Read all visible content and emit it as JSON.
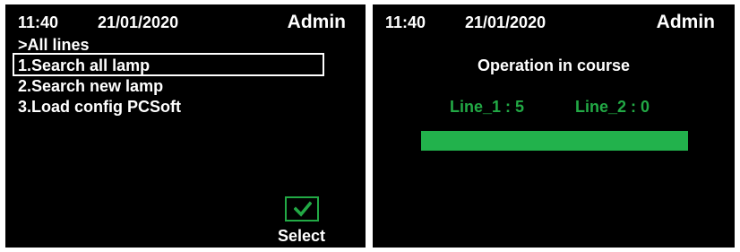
{
  "screens": [
    {
      "header": {
        "time": "11:40",
        "date": "21/01/2020",
        "user": "Admin"
      },
      "breadcrumb": ">All lines",
      "menu": [
        {
          "label": "1.Search all lamp",
          "selected": true
        },
        {
          "label": "2.Search new lamp",
          "selected": false
        },
        {
          "label": "3.Load config PCSoft",
          "selected": false
        }
      ],
      "select_button": {
        "label": "Select",
        "icon": "check-icon"
      }
    },
    {
      "header": {
        "time": "11:40",
        "date": "21/01/2020",
        "user": "Admin"
      },
      "status": "Operation in course",
      "lines": [
        {
          "label": "Line_1 : 5"
        },
        {
          "label": "Line_2 : 0"
        }
      ],
      "progress": {
        "fraction": 1.0
      }
    }
  ],
  "colors": {
    "accent": "#22a945",
    "background": "#000000",
    "text": "#ffffff"
  }
}
